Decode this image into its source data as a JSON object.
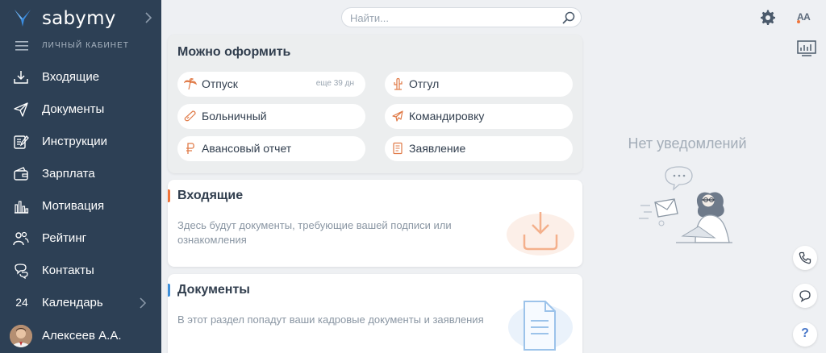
{
  "app": {
    "name": "sabymy"
  },
  "sidebar": {
    "section_label": "Личный кабинет",
    "items": [
      {
        "label": "Входящие",
        "icon": "inbox-icon"
      },
      {
        "label": "Документы",
        "icon": "paper-plane-icon"
      },
      {
        "label": "Инструкции",
        "icon": "instructions-icon"
      },
      {
        "label": "Зарплата",
        "icon": "wallet-icon"
      },
      {
        "label": "Мотивация",
        "icon": "bar-chart-icon"
      },
      {
        "label": "Рейтинг",
        "icon": "people-icon"
      },
      {
        "label": "Контакты",
        "icon": "chat-icon"
      },
      {
        "label": "Календарь",
        "icon": "calendar-icon",
        "day": "24"
      }
    ],
    "user": {
      "name": "Алексеев А.А."
    }
  },
  "search": {
    "placeholder": "Найти..."
  },
  "issue_card": {
    "title": "Можно оформить",
    "items": [
      {
        "label": "Отпуск",
        "extra": "еще 39 дн",
        "icon": "palm-icon"
      },
      {
        "label": "Отгул",
        "icon": "cactus-icon"
      },
      {
        "label": "Больничный",
        "icon": "thermometer-icon"
      },
      {
        "label": "Командировку",
        "icon": "plane-icon"
      },
      {
        "label": "Авансовый отчет",
        "icon": "ruble-icon"
      },
      {
        "label": "Заявление",
        "icon": "document-icon"
      }
    ]
  },
  "inbox_card": {
    "title": "Входящие",
    "description": "Здесь будут документы, требующие вашей подписи или ознакомления"
  },
  "docs_card": {
    "title": "Документы",
    "description": "В этот раздел попадут ваши кадровые документы и заявления"
  },
  "notifications": {
    "empty_text": "Нет уведомлений"
  },
  "help": {
    "label": "?"
  },
  "colors": {
    "sidebar_bg": "#2d4055",
    "accent_orange": "#f0743a",
    "accent_blue": "#3d8fd9",
    "icon_orange": "#e07a47"
  }
}
